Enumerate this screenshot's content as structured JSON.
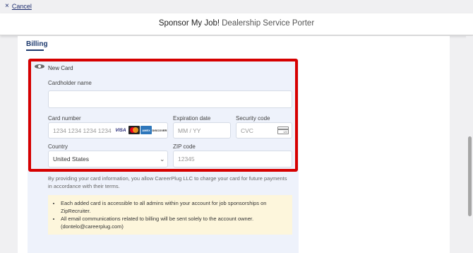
{
  "topbar": {
    "cancel_icon": "×",
    "cancel_label": "Cancel"
  },
  "header": {
    "title_strong": "Sponsor My Job!",
    "title_rest": "Dealership Service Porter"
  },
  "billing": {
    "heading": "Billing"
  },
  "payment": {
    "new_card_label": "New Card",
    "cardholder": {
      "label": "Cardholder name",
      "value": ""
    },
    "card_number": {
      "label": "Card number",
      "placeholder": "1234 1234 1234 1234",
      "brands": [
        "VISA",
        "mastercard",
        "AMERICAN EXPRESS",
        "DISCOVER"
      ]
    },
    "expiration": {
      "label": "Expiration date",
      "placeholder": "MM / YY"
    },
    "security": {
      "label": "Security code",
      "placeholder": "CVC",
      "icon": "card-cvc-icon"
    },
    "country": {
      "label": "Country",
      "value": "United States",
      "icon": "chevron-down-icon"
    },
    "zip": {
      "label": "ZIP code",
      "placeholder": "12345"
    }
  },
  "disclaimer": "By providing your card information, you allow CareerPlug LLC to charge your card for future payments in accordance with their terms.",
  "notice": {
    "items": [
      "Each added card is accessible to all admins within your account for job sponsorships on ZipRecruiter.",
      "All email communications related to billing will be sent solely to the account owner. (dontelo@careerplug.com)"
    ]
  },
  "colors": {
    "highlight": "#d60000",
    "accent": "#1e3a6e",
    "panel": "#eef2fb",
    "notice_bg": "#fdf6dc"
  }
}
